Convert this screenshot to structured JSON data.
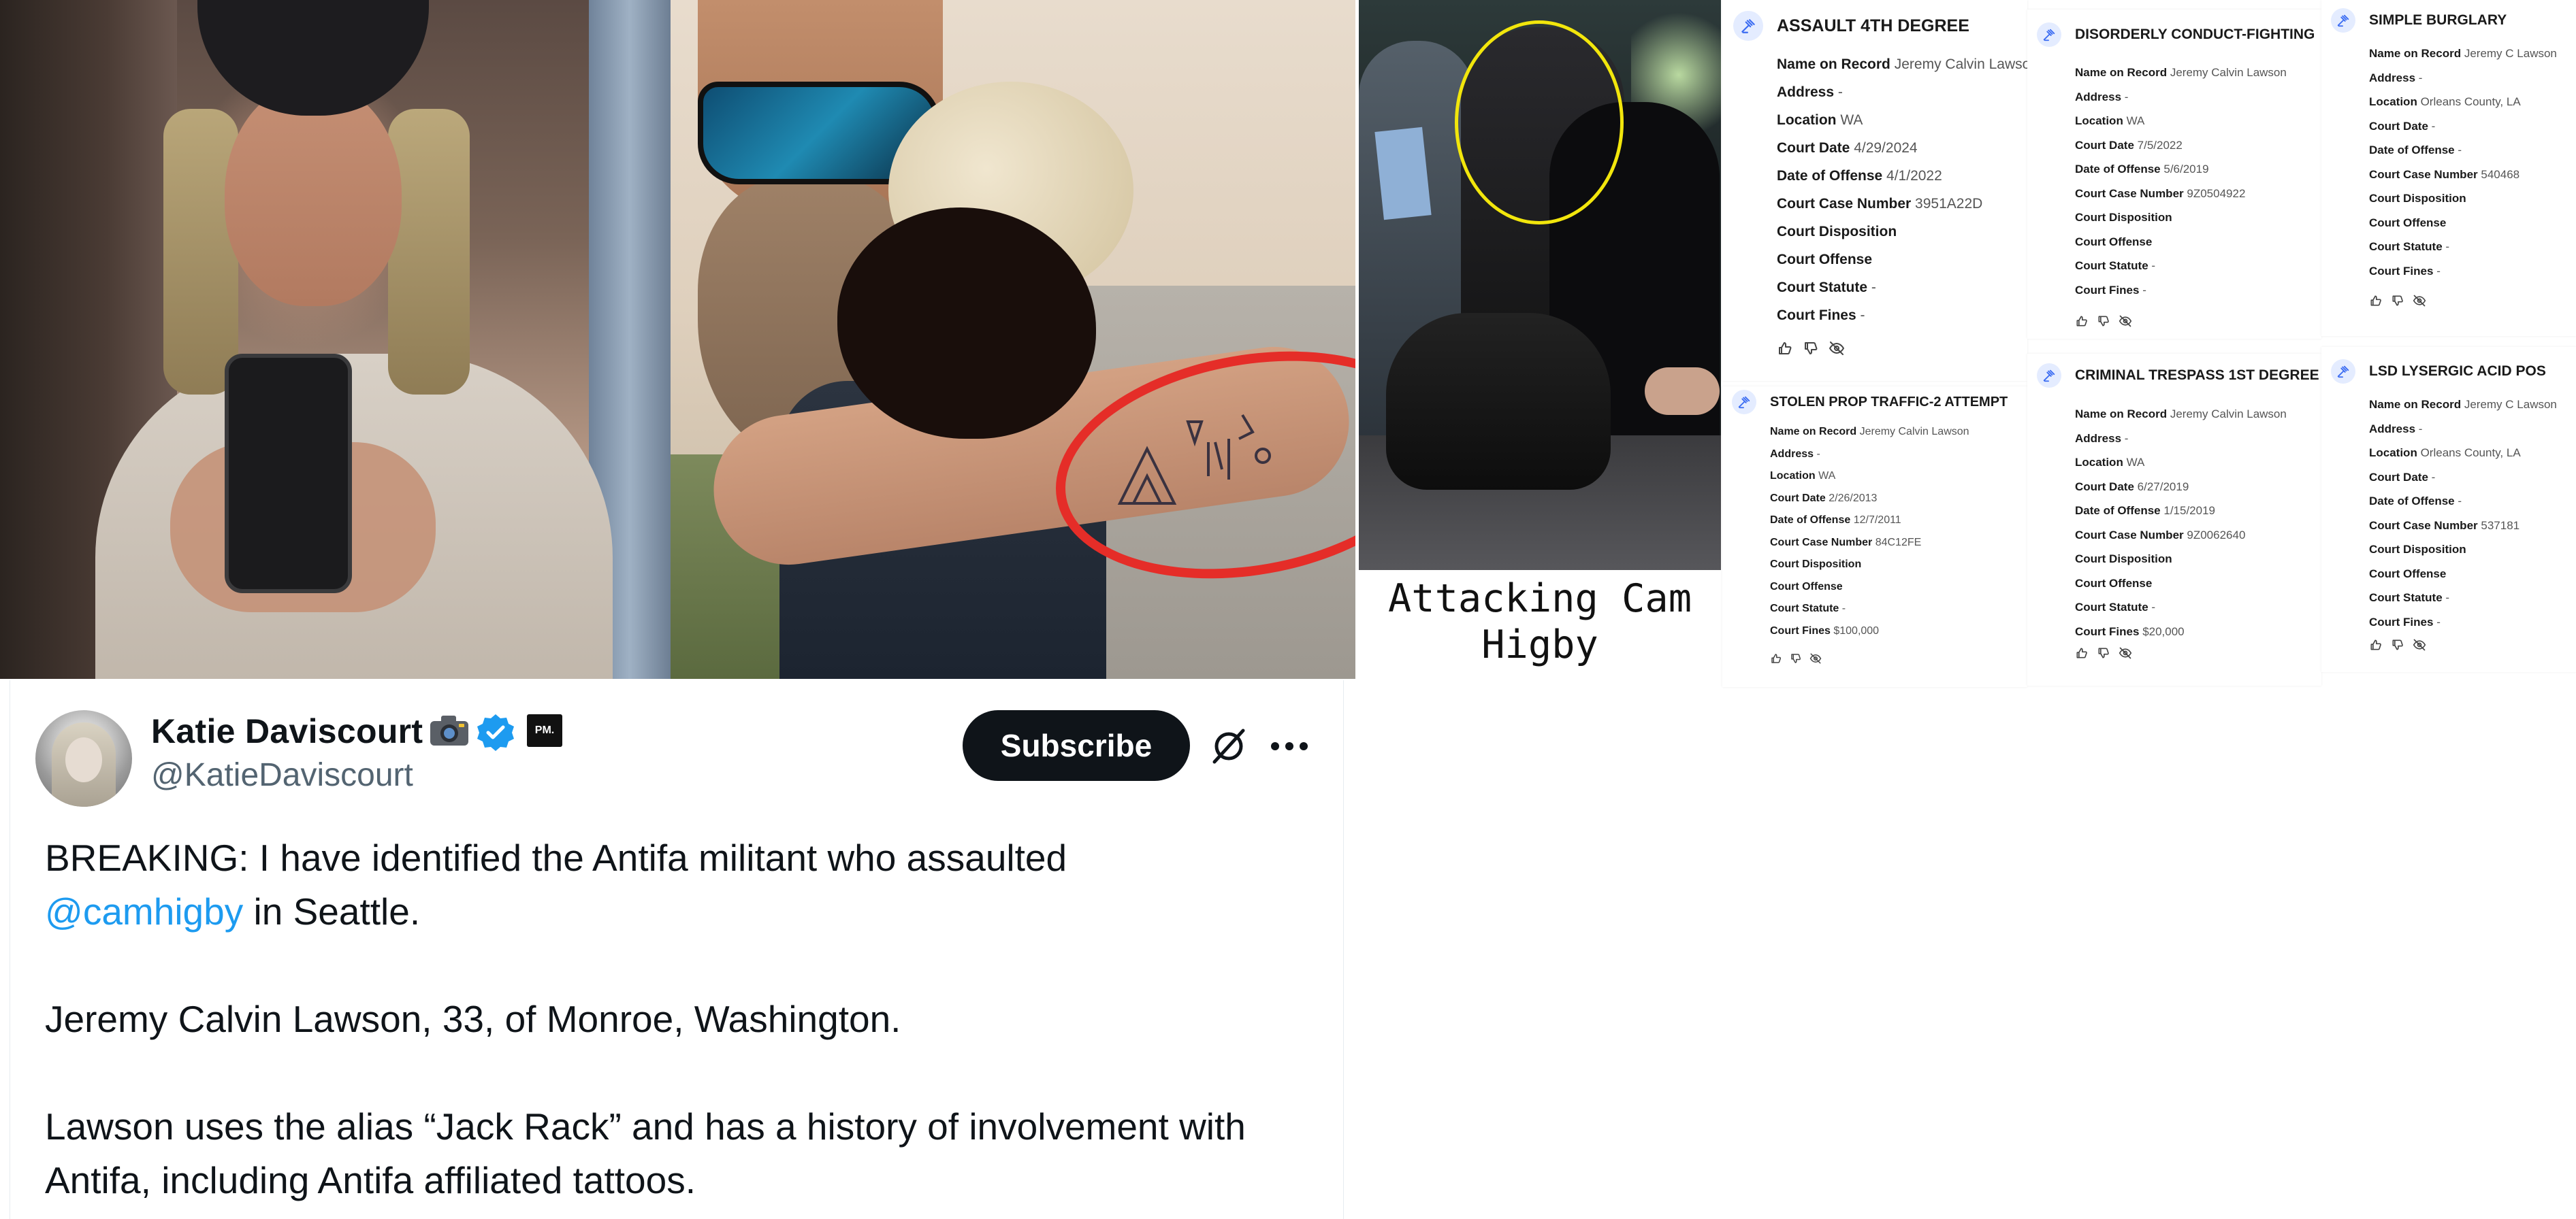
{
  "caption": {
    "line1": "Attacking Cam",
    "line2": "Higby"
  },
  "tweet": {
    "display_name": "Katie Daviscourt",
    "badge_label": "PM.",
    "handle": "@KatieDaviscourt",
    "subscribe_label": "Subscribe",
    "line1": "BREAKING: I have identified the Antifa militant who assaulted",
    "mention": "@camhigby",
    "line2_rest": " in Seattle.",
    "line3": "Jeremy Calvin Lawson, 33, of Monroe, Washington.",
    "line4": "Lawson uses the alias “Jack Rack” and has a history of involvement with",
    "line5": "Antifa, including Antifa affiliated tattoos.",
    "colors": {
      "mention": "#1d9bf0",
      "subscribe_bg": "#0f1419",
      "verified": "#1d9bf0"
    }
  },
  "records": [
    {
      "title": "ASSAULT 4TH DEGREE",
      "rows": [
        {
          "k": "Name on Record",
          "v": "Jeremy Calvin Lawson"
        },
        {
          "k": "Address",
          "v": "-"
        },
        {
          "k": "Location",
          "v": "WA"
        },
        {
          "k": "Court Date",
          "v": "4/29/2024"
        },
        {
          "k": "Date of Offense",
          "v": "4/1/2022"
        },
        {
          "k": "Court Case Number",
          "v": "3951A22D"
        },
        {
          "k": "Court Disposition",
          "v": ""
        },
        {
          "k": "Court Offense",
          "v": ""
        },
        {
          "k": "Court Statute",
          "v": "-"
        },
        {
          "k": "Court Fines",
          "v": "-"
        }
      ]
    },
    {
      "title": "STOLEN PROP TRAFFIC-2 ATTEMPT",
      "rows": [
        {
          "k": "Name on Record",
          "v": "Jeremy Calvin Lawson"
        },
        {
          "k": "Address",
          "v": "-"
        },
        {
          "k": "Location",
          "v": "WA"
        },
        {
          "k": "Court Date",
          "v": "2/26/2013"
        },
        {
          "k": "Date of Offense",
          "v": "12/7/2011"
        },
        {
          "k": "Court Case Number",
          "v": "84C12FE"
        },
        {
          "k": "Court Disposition",
          "v": ""
        },
        {
          "k": "Court Offense",
          "v": ""
        },
        {
          "k": "Court Statute",
          "v": "-"
        },
        {
          "k": "Court Fines",
          "v": "$100,000"
        }
      ]
    },
    {
      "title": "DISORDERLY CONDUCT-FIGHTING",
      "rows": [
        {
          "k": "Name on Record",
          "v": "Jeremy Calvin Lawson"
        },
        {
          "k": "Address",
          "v": "-"
        },
        {
          "k": "Location",
          "v": "WA"
        },
        {
          "k": "Court Date",
          "v": "7/5/2022"
        },
        {
          "k": "Date of Offense",
          "v": "5/6/2019"
        },
        {
          "k": "Court Case Number",
          "v": "9Z0504922"
        },
        {
          "k": "Court Disposition",
          "v": ""
        },
        {
          "k": "Court Offense",
          "v": ""
        },
        {
          "k": "Court Statute",
          "v": "-"
        },
        {
          "k": "Court Fines",
          "v": "-"
        }
      ]
    },
    {
      "title": "CRIMINAL TRESPASS 1ST DEGREE",
      "rows": [
        {
          "k": "Name on Record",
          "v": "Jeremy Calvin Lawson"
        },
        {
          "k": "Address",
          "v": "-"
        },
        {
          "k": "Location",
          "v": "WA"
        },
        {
          "k": "Court Date",
          "v": "6/27/2019"
        },
        {
          "k": "Date of Offense",
          "v": "1/15/2019"
        },
        {
          "k": "Court Case Number",
          "v": "9Z0062640"
        },
        {
          "k": "Court Disposition",
          "v": ""
        },
        {
          "k": "Court Offense",
          "v": ""
        },
        {
          "k": "Court Statute",
          "v": "-"
        },
        {
          "k": "Court Fines",
          "v": "$20,000"
        }
      ]
    },
    {
      "title": "SIMPLE BURGLARY",
      "rows": [
        {
          "k": "Name on Record",
          "v": "Jeremy C Lawson"
        },
        {
          "k": "Address",
          "v": "-"
        },
        {
          "k": "Location",
          "v": "Orleans County, LA"
        },
        {
          "k": "Court Date",
          "v": "-"
        },
        {
          "k": "Date of Offense",
          "v": "-"
        },
        {
          "k": "Court Case Number",
          "v": "540468"
        },
        {
          "k": "Court Disposition",
          "v": ""
        },
        {
          "k": "Court Offense",
          "v": ""
        },
        {
          "k": "Court Statute",
          "v": "-"
        },
        {
          "k": "Court Fines",
          "v": "-"
        }
      ]
    },
    {
      "title": "LSD LYSERGIC ACID POS",
      "rows": [
        {
          "k": "Name on Record",
          "v": "Jeremy C Lawson"
        },
        {
          "k": "Address",
          "v": "-"
        },
        {
          "k": "Location",
          "v": "Orleans County, LA"
        },
        {
          "k": "Court Date",
          "v": "-"
        },
        {
          "k": "Date of Offense",
          "v": "-"
        },
        {
          "k": "Court Case Number",
          "v": "537181"
        },
        {
          "k": "Court Disposition",
          "v": ""
        },
        {
          "k": "Court Offense",
          "v": ""
        },
        {
          "k": "Court Statute",
          "v": "-"
        },
        {
          "k": "Court Fines",
          "v": "-"
        }
      ]
    }
  ],
  "icons": {
    "record": "gavel-icon",
    "actions": [
      "thumbs-up-icon",
      "thumbs-down-icon",
      "hide-icon"
    ],
    "tweet": [
      "camera-emoji-icon",
      "verified-badge-icon",
      "grok-icon",
      "more-icon"
    ]
  },
  "colors": {
    "ring": "#e52d28",
    "highlight_circle": "#f2e60c",
    "record_icon": "#3b6cf2"
  }
}
